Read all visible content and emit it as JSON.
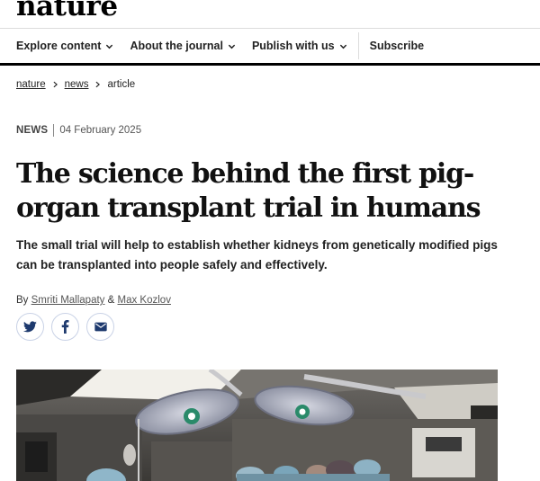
{
  "brand": {
    "logo_text": "nature"
  },
  "nav": {
    "items": [
      {
        "label": "Explore content",
        "has_dropdown": true
      },
      {
        "label": "About the journal",
        "has_dropdown": true
      },
      {
        "label": "Publish with us",
        "has_dropdown": true
      }
    ],
    "subscribe_label": "Subscribe"
  },
  "breadcrumb": {
    "items": [
      "nature",
      "news",
      "article"
    ]
  },
  "article": {
    "type": "NEWS",
    "date": "04 February 2025",
    "title": "The science behind the first pig-organ transplant trial in humans",
    "standfirst": "The small trial will help to establish whether kidneys from genetically modified pigs can be transplanted into people safely and effectively.",
    "by_label": "By",
    "authors": [
      "Smriti Mallapaty",
      "Max Kozlov"
    ],
    "author_joiner": "&"
  },
  "share": {
    "icons": [
      "twitter-icon",
      "facebook-icon",
      "email-icon"
    ]
  },
  "colors": {
    "accent_bar": "#000000",
    "share_icon": "#1e3a6e",
    "share_border": "#c9d2e6"
  }
}
